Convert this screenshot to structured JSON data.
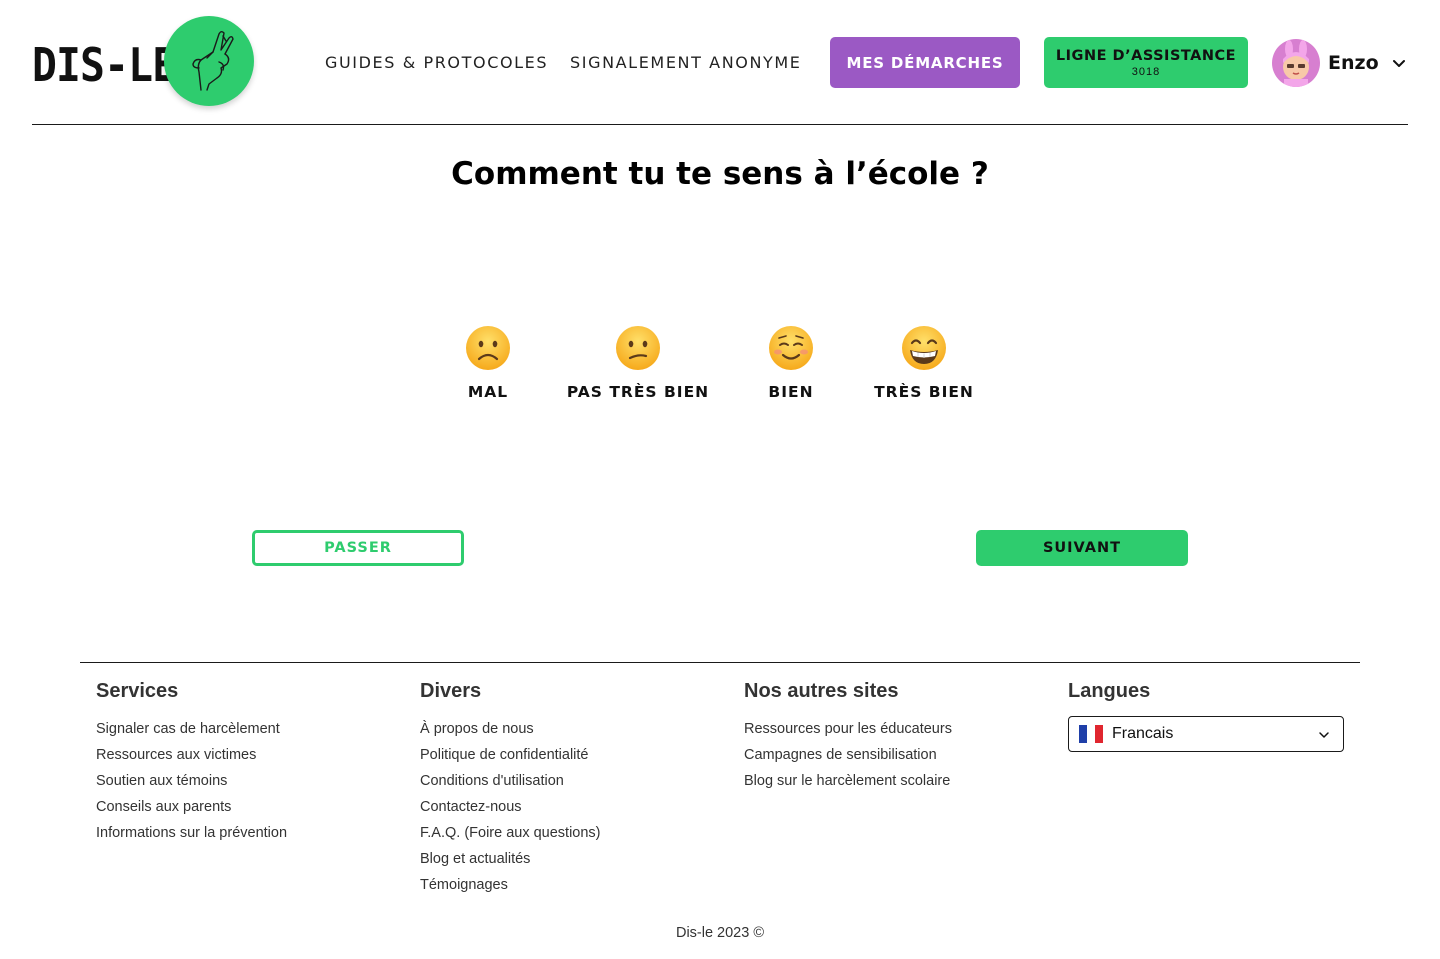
{
  "header": {
    "logo_text": "DIS-LE",
    "nav": {
      "guides": "GUIDES & PROTOCOLES",
      "signalement": "SIGNALEMENT ANONYME"
    },
    "demarches_button": "MES DÉMARCHES",
    "assistance_button": {
      "label": "LIGNE D’ASSISTANCE",
      "number": "3018"
    },
    "user": {
      "name": "Enzo"
    }
  },
  "main": {
    "question": "Comment tu te sens à l’école ?",
    "moods": [
      {
        "label": "MAL",
        "emoji": "frowning-face"
      },
      {
        "label": "PAS TRÈS BIEN",
        "emoji": "confused-face"
      },
      {
        "label": "BIEN",
        "emoji": "smiling-face"
      },
      {
        "label": "TRÈS BIEN",
        "emoji": "beaming-face"
      }
    ],
    "skip_button": "PASSER",
    "next_button": "SUIVANT"
  },
  "footer": {
    "services": {
      "title": "Services",
      "links": [
        "Signaler cas de harcèlement",
        "Ressources aux victimes",
        "Soutien aux témoins",
        "Conseils aux parents",
        "Informations sur la prévention"
      ]
    },
    "divers": {
      "title": "Divers",
      "links": [
        "À propos de nous",
        "Politique de confidentialité",
        "Conditions d'utilisation",
        "Contactez-nous",
        "F.A.Q. (Foire aux questions)",
        "Blog et actualités",
        "Témoignages"
      ]
    },
    "sites": {
      "title": "Nos autres sites",
      "links": [
        "Ressources pour les éducateurs",
        "Campagnes de sensibilisation",
        "Blog sur le harcèlement scolaire"
      ]
    },
    "langues": {
      "title": "Langues",
      "selected": "Francais"
    },
    "copyright": "Dis-le 2023 ©"
  },
  "colors": {
    "green": "#2ecc6e",
    "purple": "#9b59c4",
    "emoji_yellow": "#fbc02d"
  }
}
